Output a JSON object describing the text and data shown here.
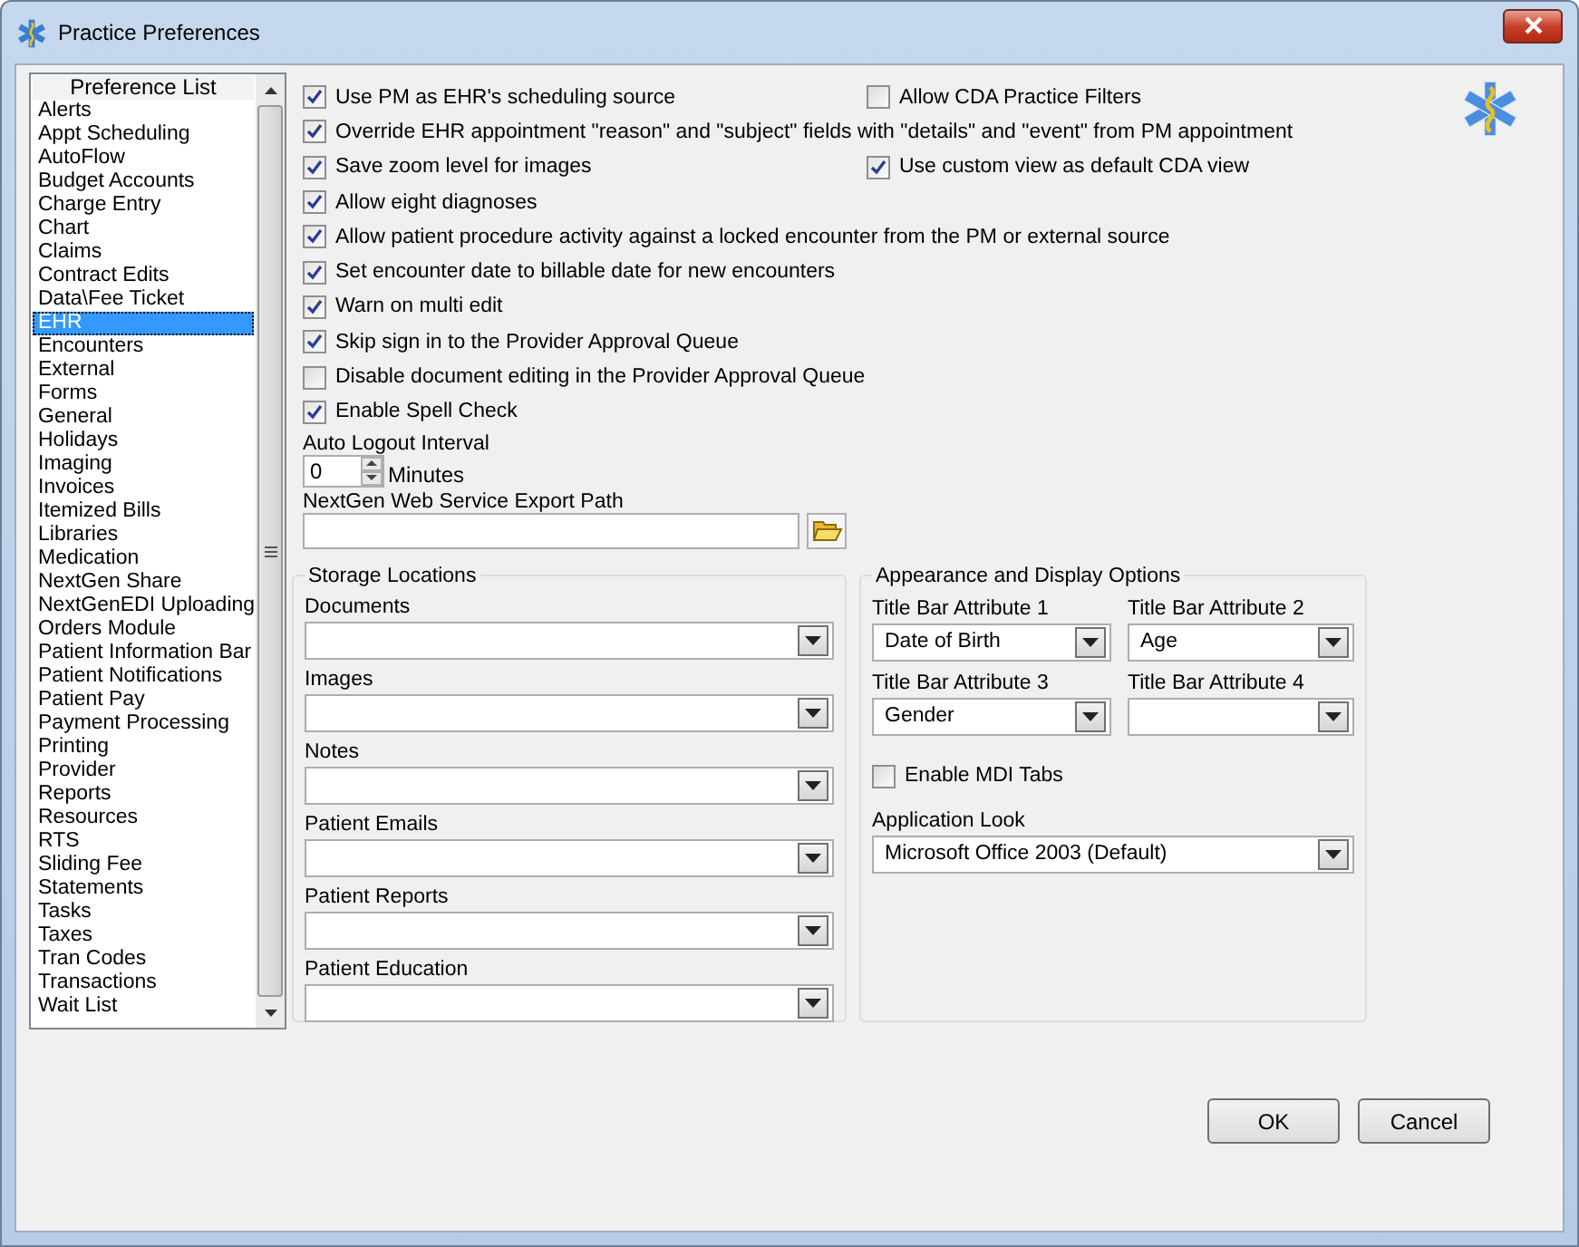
{
  "window": {
    "title": "Practice Preferences"
  },
  "preference_list": {
    "header": "Preference List",
    "items": [
      {
        "label": "Alerts",
        "selected": false
      },
      {
        "label": "Appt Scheduling",
        "selected": false
      },
      {
        "label": "AutoFlow",
        "selected": false
      },
      {
        "label": "Budget Accounts",
        "selected": false
      },
      {
        "label": "Charge Entry",
        "selected": false
      },
      {
        "label": "Chart",
        "selected": false
      },
      {
        "label": "Claims",
        "selected": false
      },
      {
        "label": "Contract Edits",
        "selected": false
      },
      {
        "label": "Data\\Fee Ticket",
        "selected": false
      },
      {
        "label": "EHR",
        "selected": true
      },
      {
        "label": "Encounters",
        "selected": false
      },
      {
        "label": "External",
        "selected": false
      },
      {
        "label": "Forms",
        "selected": false
      },
      {
        "label": "General",
        "selected": false
      },
      {
        "label": "Holidays",
        "selected": false
      },
      {
        "label": "Imaging",
        "selected": false
      },
      {
        "label": "Invoices",
        "selected": false
      },
      {
        "label": "Itemized Bills",
        "selected": false
      },
      {
        "label": "Libraries",
        "selected": false
      },
      {
        "label": "Medication",
        "selected": false
      },
      {
        "label": "NextGen Share",
        "selected": false
      },
      {
        "label": "NextGenEDI Uploading",
        "selected": false
      },
      {
        "label": "Orders Module",
        "selected": false
      },
      {
        "label": "Patient Information Bar",
        "selected": false
      },
      {
        "label": "Patient Notifications",
        "selected": false
      },
      {
        "label": "Patient Pay",
        "selected": false
      },
      {
        "label": "Payment Processing",
        "selected": false
      },
      {
        "label": "Printing",
        "selected": false
      },
      {
        "label": "Provider",
        "selected": false
      },
      {
        "label": "Reports",
        "selected": false
      },
      {
        "label": "Resources",
        "selected": false
      },
      {
        "label": "RTS",
        "selected": false
      },
      {
        "label": "Sliding Fee",
        "selected": false
      },
      {
        "label": "Statements",
        "selected": false
      },
      {
        "label": "Tasks",
        "selected": false
      },
      {
        "label": "Taxes",
        "selected": false
      },
      {
        "label": "Tran Codes",
        "selected": false
      },
      {
        "label": "Transactions",
        "selected": false
      },
      {
        "label": "Wait List",
        "selected": false
      }
    ]
  },
  "option_rows": [
    [
      {
        "label": "Use PM as EHR's scheduling source",
        "checked": true
      },
      {
        "label": "Allow CDA Practice Filters",
        "checked": false
      }
    ],
    [
      {
        "label": "Override EHR appointment \"reason\" and \"subject\" fields with \"details\" and \"event\" from PM appointment",
        "checked": true
      }
    ],
    [
      {
        "label": "Save zoom level for images",
        "checked": true
      },
      {
        "label": "Use custom view as default CDA view",
        "checked": true
      }
    ],
    [
      {
        "label": "Allow eight diagnoses",
        "checked": true
      }
    ],
    [
      {
        "label": "Allow patient procedure activity against a locked encounter from the PM or external source",
        "checked": true
      }
    ],
    [
      {
        "label": "Set encounter date to billable date for new encounters",
        "checked": true
      }
    ],
    [
      {
        "label": "Warn on multi edit",
        "checked": true
      }
    ],
    [
      {
        "label": "Skip sign in to the Provider Approval Queue",
        "checked": true
      }
    ],
    [
      {
        "label": "Disable document editing in the Provider Approval Queue",
        "checked": false
      }
    ],
    [
      {
        "label": "Enable Spell Check",
        "checked": true
      }
    ]
  ],
  "auto_logout": {
    "label": "Auto Logout Interval",
    "value": "0",
    "unit": "Minutes"
  },
  "export_path": {
    "label": "NextGen Web Service Export Path"
  },
  "storage_locations": {
    "title": "Storage Locations",
    "fields": [
      {
        "label": "Documents"
      },
      {
        "label": "Images"
      },
      {
        "label": "Notes"
      },
      {
        "label": "Patient Emails"
      },
      {
        "label": "Patient Reports"
      },
      {
        "label": "Patient Education"
      }
    ]
  },
  "appearance": {
    "title": "Appearance and Display Options",
    "attributes": [
      {
        "label": "Title Bar Attribute 1",
        "value": "Date of Birth"
      },
      {
        "label": "Title Bar Attribute 2",
        "value": "Age"
      },
      {
        "label": "Title Bar Attribute 3",
        "value": "Gender"
      },
      {
        "label": "Title Bar Attribute 4"
      }
    ],
    "mdi_tabs": {
      "label": "Enable MDI Tabs",
      "checked": false
    },
    "application_look": {
      "label": "Application Look",
      "value": "Microsoft Office 2003 (Default)"
    }
  },
  "buttons": [
    "OK",
    "Cancel"
  ]
}
